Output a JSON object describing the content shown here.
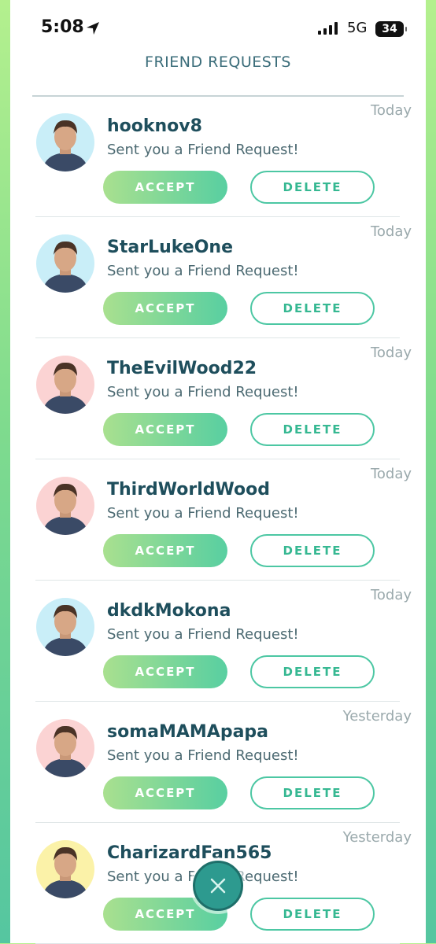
{
  "status_bar": {
    "time": "5:08",
    "network": "5G",
    "battery": "34",
    "icons": [
      "location-arrow-icon",
      "signal-bars-icon",
      "battery-icon"
    ]
  },
  "header": {
    "title": "FRIEND REQUESTS"
  },
  "colors": {
    "title": "#3b6d7a",
    "username": "#1e4e5c",
    "accept_gradient_start": "#a9e08f",
    "accept_gradient_end": "#58cfa1",
    "delete_border": "#4cc7a3",
    "background_top": "#b4f08e",
    "background_bottom": "#55c6a0"
  },
  "requests": [
    {
      "username": "hooknov8",
      "message": "Sent you a Friend Request!",
      "date": "Today",
      "accept_label": "ACCEPT",
      "delete_label": "DELETE",
      "avatar_bg": "#c9eef8"
    },
    {
      "username": "StarLukeOne",
      "message": "Sent you a Friend Request!",
      "date": "Today",
      "accept_label": "ACCEPT",
      "delete_label": "DELETE",
      "avatar_bg": "#c9eef8"
    },
    {
      "username": "TheEvilWood22",
      "message": "Sent you a Friend Request!",
      "date": "Today",
      "accept_label": "ACCEPT",
      "delete_label": "DELETE",
      "avatar_bg": "#fbd3d3"
    },
    {
      "username": "ThirdWorldWood",
      "message": "Sent you a Friend Request!",
      "date": "Today",
      "accept_label": "ACCEPT",
      "delete_label": "DELETE",
      "avatar_bg": "#fbd3d3"
    },
    {
      "username": "dkdkMokona",
      "message": "Sent you a Friend Request!",
      "date": "Today",
      "accept_label": "ACCEPT",
      "delete_label": "DELETE",
      "avatar_bg": "#c9eef8"
    },
    {
      "username": "somaMAMApapa",
      "message": "Sent you a Friend Request!",
      "date": "Yesterday",
      "accept_label": "ACCEPT",
      "delete_label": "DELETE",
      "avatar_bg": "#fbd3d3"
    },
    {
      "username": "CharizardFan565",
      "message": "Sent you a Friend Request!",
      "date": "Yesterday",
      "accept_label": "ACCEPT",
      "delete_label": "DELETE",
      "avatar_bg": "#fbf2a8"
    }
  ],
  "close_button": {
    "icon": "close-icon"
  }
}
